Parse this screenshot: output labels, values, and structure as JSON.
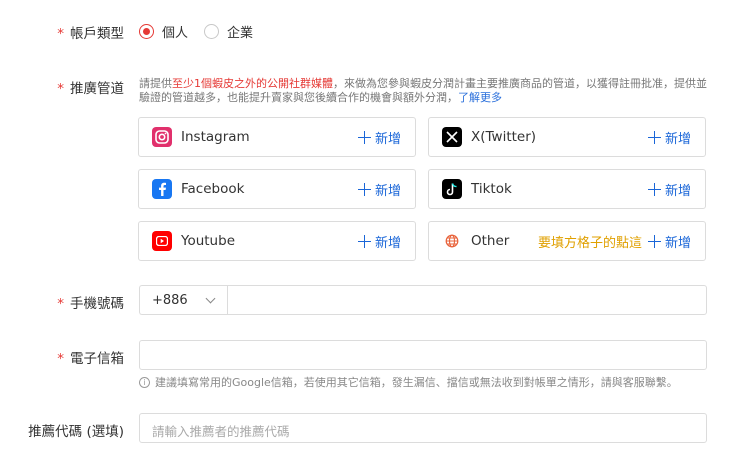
{
  "required_mark": "*",
  "account_type": {
    "label": "帳戶類型",
    "options": [
      {
        "label": "個人",
        "checked": true
      },
      {
        "label": "企業",
        "checked": false
      }
    ]
  },
  "promotion": {
    "label": "推廣管道",
    "desc_1": "請提供",
    "desc_highlight": "至少1個蝦皮之外的公開社群媒體",
    "desc_2": "，來做為您參與蝦皮分潤計畫主要推廣商品的管道，以獲得註冊批准，提供並驗證的管道越多，也能提升賣家與您後續合作的機會與額外分潤，",
    "learn_more": "了解更多",
    "add_label": "新增",
    "channels": [
      {
        "name": "Instagram",
        "icon": "instagram-icon",
        "color": "#e1306c"
      },
      {
        "name": "X(Twitter)",
        "icon": "x-twitter-icon",
        "color": "#000000"
      },
      {
        "name": "Facebook",
        "icon": "facebook-icon",
        "color": "#1877f2"
      },
      {
        "name": "Tiktok",
        "icon": "tiktok-icon",
        "color": "#000000"
      },
      {
        "name": "Youtube",
        "icon": "youtube-icon",
        "color": "#ff0000"
      },
      {
        "name": "Other",
        "icon": "globe-icon",
        "color": "#e8623a",
        "note": "要填方格子的點這"
      }
    ]
  },
  "phone": {
    "label": "手機號碼",
    "country_code": "+886"
  },
  "email": {
    "label": "電子信箱",
    "hint": "建議填寫常用的Google信箱，若使用其它信箱，發生漏信、擋信或無法收到對帳單之情形，請與客服聯繫。"
  },
  "referral": {
    "label": "推薦代碼 (選填)",
    "placeholder": "請輸入推薦者的推薦代碼"
  },
  "colors": {
    "required": "#e53935",
    "accent_blue": "#1a66d8",
    "note_orange": "#e0a000"
  }
}
